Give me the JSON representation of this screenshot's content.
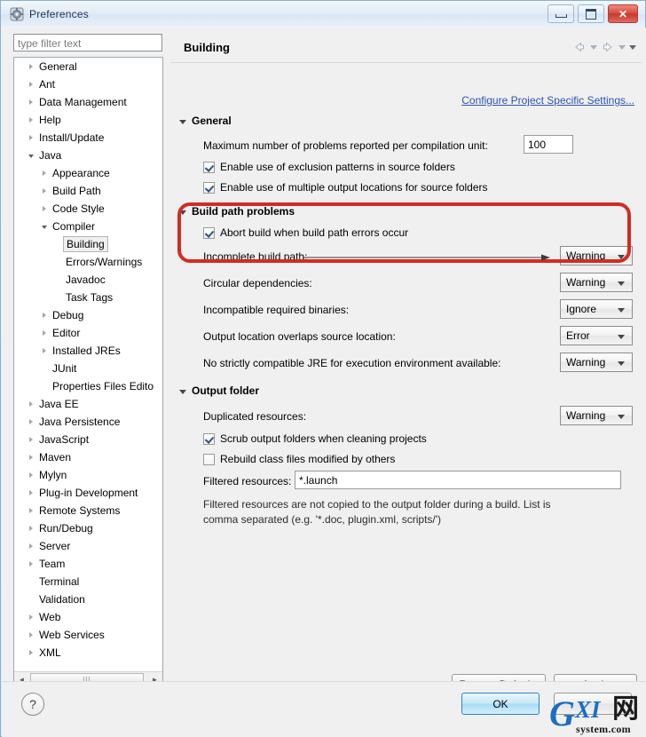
{
  "window": {
    "title": "Preferences",
    "icon": "preferences-gear-icon",
    "controls": {
      "minimize": "minimize-icon",
      "maximize": "restore-icon",
      "close": "✕"
    }
  },
  "sidebar": {
    "filter": {
      "placeholder": "type filter text",
      "value": ""
    },
    "items": [
      {
        "label": "General",
        "indent": 0,
        "twisty": "collapsed"
      },
      {
        "label": "Ant",
        "indent": 0,
        "twisty": "collapsed"
      },
      {
        "label": "Data Management",
        "indent": 0,
        "twisty": "collapsed"
      },
      {
        "label": "Help",
        "indent": 0,
        "twisty": "collapsed"
      },
      {
        "label": "Install/Update",
        "indent": 0,
        "twisty": "collapsed"
      },
      {
        "label": "Java",
        "indent": 0,
        "twisty": "expanded"
      },
      {
        "label": "Appearance",
        "indent": 1,
        "twisty": "collapsed"
      },
      {
        "label": "Build Path",
        "indent": 1,
        "twisty": "collapsed"
      },
      {
        "label": "Code Style",
        "indent": 1,
        "twisty": "collapsed"
      },
      {
        "label": "Compiler",
        "indent": 1,
        "twisty": "expanded"
      },
      {
        "label": "Building",
        "indent": 2,
        "twisty": "none",
        "selected": true
      },
      {
        "label": "Errors/Warnings",
        "indent": 2,
        "twisty": "none"
      },
      {
        "label": "Javadoc",
        "indent": 2,
        "twisty": "none"
      },
      {
        "label": "Task Tags",
        "indent": 2,
        "twisty": "none"
      },
      {
        "label": "Debug",
        "indent": 1,
        "twisty": "collapsed"
      },
      {
        "label": "Editor",
        "indent": 1,
        "twisty": "collapsed"
      },
      {
        "label": "Installed JREs",
        "indent": 1,
        "twisty": "collapsed"
      },
      {
        "label": "JUnit",
        "indent": 1,
        "twisty": "none"
      },
      {
        "label": "Properties Files Edito",
        "indent": 1,
        "twisty": "none"
      },
      {
        "label": "Java EE",
        "indent": 0,
        "twisty": "collapsed"
      },
      {
        "label": "Java Persistence",
        "indent": 0,
        "twisty": "collapsed"
      },
      {
        "label": "JavaScript",
        "indent": 0,
        "twisty": "collapsed"
      },
      {
        "label": "Maven",
        "indent": 0,
        "twisty": "collapsed"
      },
      {
        "label": "Mylyn",
        "indent": 0,
        "twisty": "collapsed"
      },
      {
        "label": "Plug-in Development",
        "indent": 0,
        "twisty": "collapsed"
      },
      {
        "label": "Remote Systems",
        "indent": 0,
        "twisty": "collapsed"
      },
      {
        "label": "Run/Debug",
        "indent": 0,
        "twisty": "collapsed"
      },
      {
        "label": "Server",
        "indent": 0,
        "twisty": "collapsed"
      },
      {
        "label": "Team",
        "indent": 0,
        "twisty": "collapsed"
      },
      {
        "label": "Terminal",
        "indent": 0,
        "twisty": "none"
      },
      {
        "label": "Validation",
        "indent": 0,
        "twisty": "none"
      },
      {
        "label": "Web",
        "indent": 0,
        "twisty": "collapsed"
      },
      {
        "label": "Web Services",
        "indent": 0,
        "twisty": "collapsed"
      },
      {
        "label": "XML",
        "indent": 0,
        "twisty": "collapsed"
      }
    ]
  },
  "page": {
    "title": "Building",
    "configure_link": "Configure Project Specific Settings...",
    "nav": {
      "back": "back-arrow-icon",
      "back_menu": "chevron-down-icon",
      "forward": "forward-arrow-icon",
      "forward_menu": "chevron-down-icon",
      "view_menu": "chevron-down-icon"
    },
    "sections": {
      "general": {
        "title": "General",
        "max_problems_label": "Maximum number of problems reported per compilation unit:",
        "max_problems_value": "100",
        "exclusion_patterns": "Enable use of exclusion patterns in source folders",
        "multiple_output": "Enable use of multiple output locations for source folders"
      },
      "build_path_problems": {
        "title": "Build path problems",
        "abort_build": "Abort build when build path errors occur",
        "rows": [
          {
            "label": "Incomplete build path:",
            "value": "Warning"
          },
          {
            "label": "Circular dependencies:",
            "value": "Warning"
          },
          {
            "label": "Incompatible required binaries:",
            "value": "Ignore"
          },
          {
            "label": "Output location overlaps source location:",
            "value": "Error"
          },
          {
            "label": "No strictly compatible JRE for execution environment available:",
            "value": "Warning"
          }
        ]
      },
      "output_folder": {
        "title": "Output folder",
        "duplicated_label": "Duplicated resources:",
        "duplicated_value": "Warning",
        "scrub_label": "Scrub output folders when cleaning projects",
        "rebuild_label": "Rebuild class files modified by others",
        "filtered_label": "Filtered resources:",
        "filtered_value": "*.launch",
        "help_line1": "Filtered resources are not copied to the output folder during a build. List is",
        "help_line2": "comma separated (e.g. '*.doc, plugin.xml, scripts/')"
      }
    },
    "buttons": {
      "restore_defaults": "Restore Defaults",
      "apply": "Apply"
    }
  },
  "footer": {
    "help": "?",
    "ok": "OK",
    "cancel": ""
  },
  "annotations": {
    "highlight_color": "#d32b22",
    "box_target": "build-path-problems-warning-rows",
    "arrow_from": "Circular dependencies:",
    "arrow_to": "Warning"
  },
  "watermark": {
    "main": "G",
    "mid": "XI",
    "cn": "网",
    "sub": "system.com",
    "color": "#1b6ec2"
  }
}
